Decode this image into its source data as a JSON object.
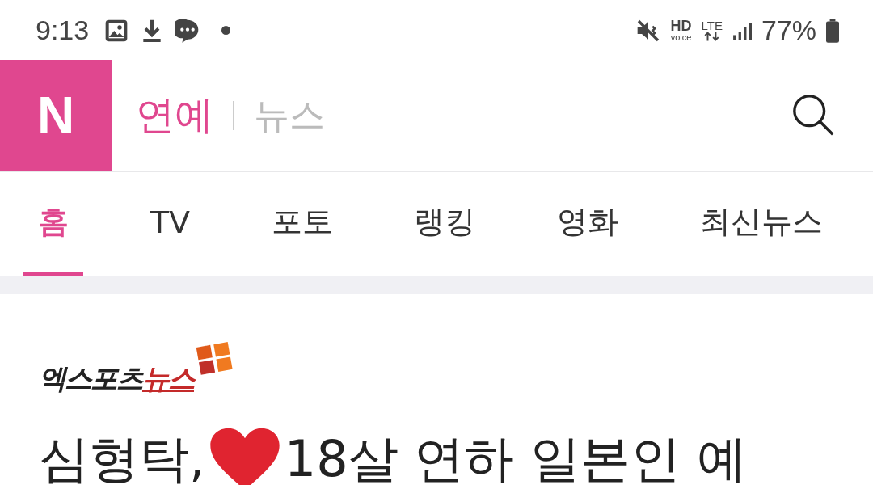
{
  "status_bar": {
    "time": "9:13",
    "hd": "HD",
    "voice": "voice",
    "network": "LTE",
    "battery": "77%"
  },
  "header": {
    "logo": "N",
    "section": "연예",
    "subsection": "뉴스"
  },
  "tabs": [
    {
      "label": "홈",
      "selected": true
    },
    {
      "label": "TV",
      "selected": false
    },
    {
      "label": "포토",
      "selected": false
    },
    {
      "label": "랭킹",
      "selected": false
    },
    {
      "label": "영화",
      "selected": false
    },
    {
      "label": "최신뉴스",
      "selected": false
    }
  ],
  "article": {
    "source_logo": {
      "part_1": "엑스포츠",
      "part_2": "뉴스"
    },
    "headline_start": "심형탁,",
    "headline_rest": "18살 연하 일본인 예"
  }
}
